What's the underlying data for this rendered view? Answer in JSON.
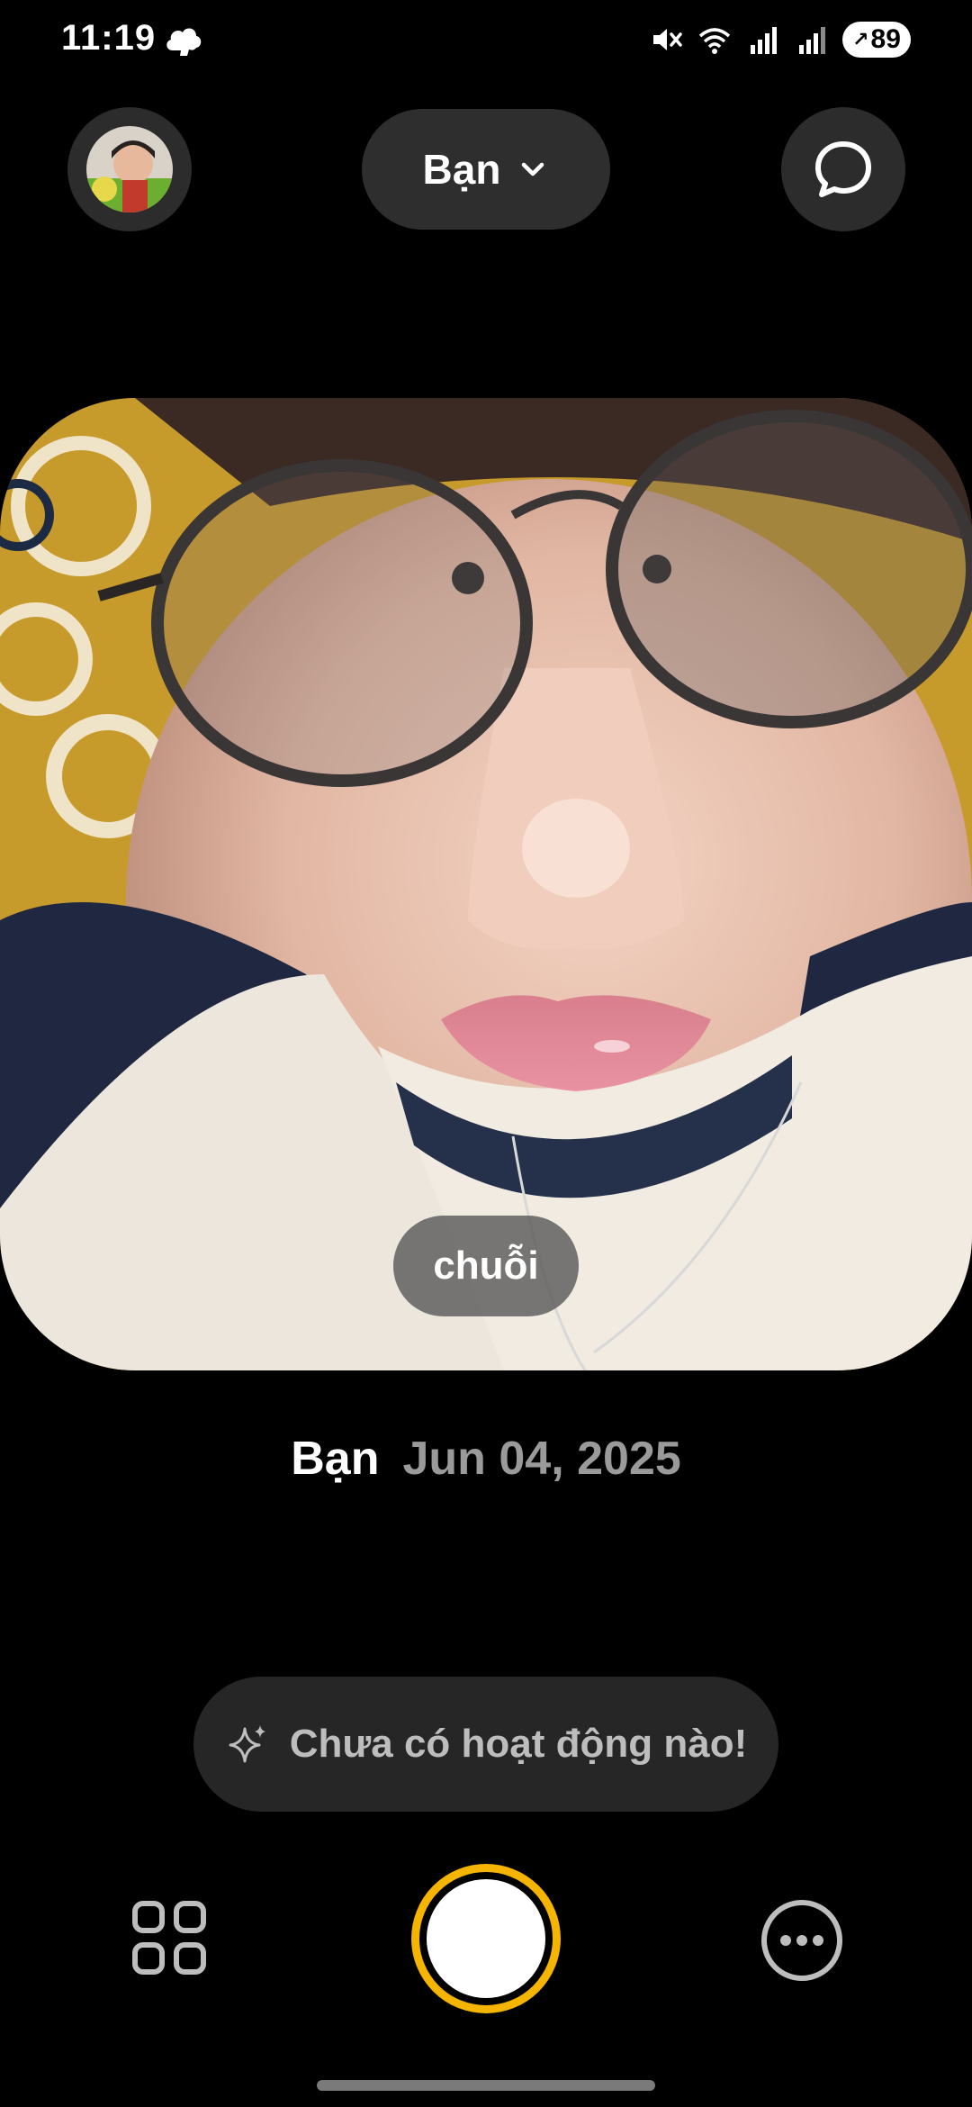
{
  "status_bar": {
    "time": "11:19",
    "battery": "89",
    "icons": [
      "cloud-icon",
      "mute-icon",
      "wifi-icon",
      "signal-icon",
      "signal-icon",
      "battery-icon"
    ]
  },
  "header": {
    "selector_label": "Bạn",
    "left_icon": "avatar",
    "right_icon": "chat-bubble-icon"
  },
  "post": {
    "caption": "chuỗi",
    "author": "Bạn",
    "date": "Jun 04, 2025"
  },
  "activity": {
    "text": "Chưa có hoạt động nào!",
    "icon": "sparkle-icon"
  },
  "bottom_bar": {
    "left_icon": "grid-icon",
    "center": "shutter-button",
    "right_icon": "more-icon"
  },
  "colors": {
    "background": "#000000",
    "pill": "#2e2e2e",
    "shutter_ring": "#f5b400",
    "muted_text": "#9a9a9a"
  }
}
